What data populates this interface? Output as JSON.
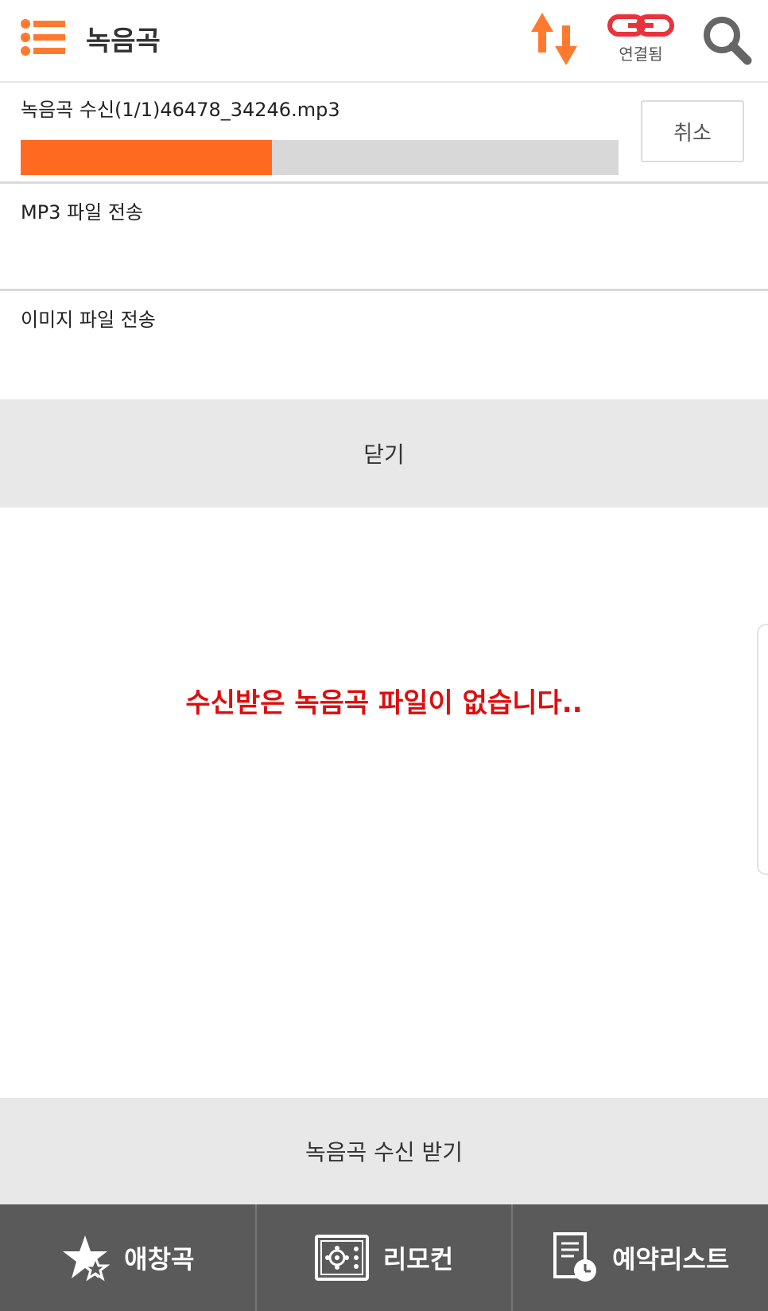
{
  "header": {
    "menu_icon": "menu-list-icon",
    "title": "녹음곡",
    "sync_icon": "sync-arrows-icon",
    "connection_icon": "link-icon",
    "connection_label": "연결됨",
    "search_icon": "search-icon"
  },
  "receive": {
    "label": "녹음곡 수신(1/1)46478_34246.mp3",
    "progress_percent": 42,
    "cancel_label": "취소"
  },
  "rows": {
    "mp3_label": "MP3 파일 전송",
    "image_label": "이미지 파일 전송"
  },
  "close_label": "닫기",
  "empty_message": "수신받은 녹음곡 파일이 없습니다..",
  "receive_button_label": "녹음곡 수신 받기",
  "nav": {
    "favorites": {
      "label": "애창곡",
      "icon": "star-icon"
    },
    "remote": {
      "label": "리모컨",
      "icon": "remote-icon"
    },
    "reservations": {
      "label": "예약리스트",
      "icon": "reservation-list-icon"
    }
  },
  "colors": {
    "accent": "#ff6a21",
    "progress_track": "#d8d8d8",
    "error_text": "#e00d0d",
    "link_red": "#e8323c",
    "nav_bg": "#5a5a5a",
    "button_bg": "#e8e8e8"
  }
}
